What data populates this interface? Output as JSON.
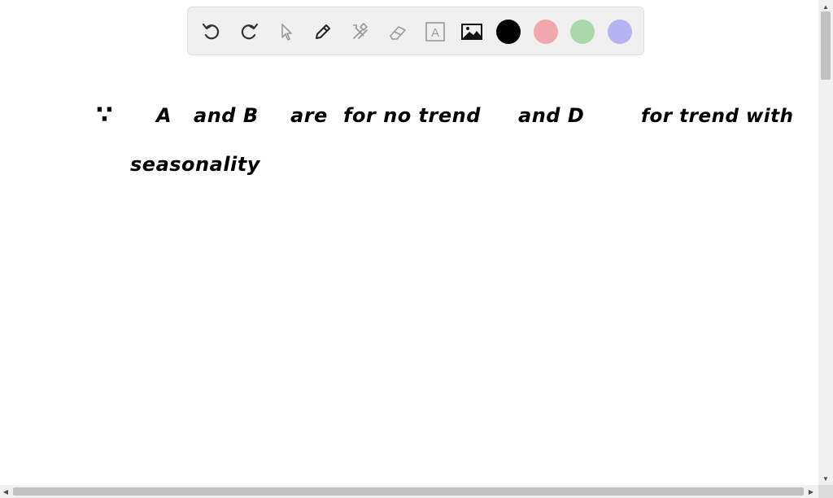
{
  "toolbar": {
    "tools": [
      {
        "name": "undo-button",
        "icon": "undo-icon"
      },
      {
        "name": "redo-button",
        "icon": "redo-icon"
      },
      {
        "name": "select-tool",
        "icon": "pointer-icon"
      },
      {
        "name": "pen-tool",
        "icon": "pencil-icon"
      },
      {
        "name": "tools-button",
        "icon": "hammer-wrench-icon"
      },
      {
        "name": "eraser-tool",
        "icon": "eraser-icon"
      },
      {
        "name": "text-tool",
        "icon": "text-box-icon",
        "glyph": "A"
      },
      {
        "name": "image-tool",
        "icon": "image-icon"
      }
    ],
    "colors": [
      "#000000",
      "#f2a7ae",
      "#a9d9aa",
      "#b7b2f2"
    ]
  },
  "note": {
    "line1": {
      "therefore": "∵",
      "w1": "A",
      "w2": "and B",
      "w3": "are",
      "w4": "for no trend",
      "w5": "and D",
      "w6": "for trend with"
    },
    "line2": "seasonality"
  }
}
